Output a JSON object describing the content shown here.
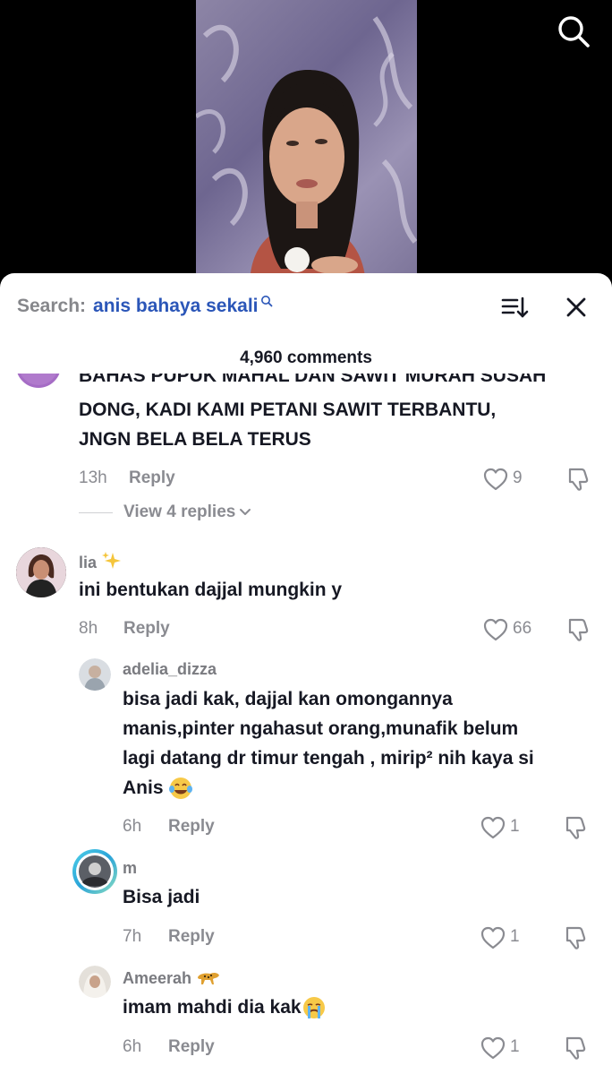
{
  "search": {
    "label": "Search:",
    "term": "anis bahaya sekali"
  },
  "comments_count": "4,960 comments",
  "comments": [
    {
      "text_cut": "BAHAS PUPUK MAHAL DAN SAWIT MURAH SUSAH",
      "text_lines": [
        "DONG, KADI KAMI PETANI SAWIT TERBANTU,",
        "JNGN BELA BELA TERUS"
      ],
      "time": "13h",
      "reply": "Reply",
      "likes": "9",
      "view_replies": "View 4 replies"
    },
    {
      "username": "lia",
      "text": "ini bentukan dajjal mungkin y",
      "time": "8h",
      "reply": "Reply",
      "likes": "66"
    }
  ],
  "replies": [
    {
      "username": "adelia_dizza",
      "text_lines": [
        "bisa jadi kak, dajjal kan omongannya",
        "manis,pinter ngahasut orang,munafik belum",
        "lagi datang dr timur tengah , mirip² nih kaya si",
        "Anis"
      ],
      "time": "6h",
      "reply": "Reply",
      "likes": "1"
    },
    {
      "username": "m",
      "text": "Bisa jadi",
      "time": "7h",
      "reply": "Reply",
      "likes": "1"
    },
    {
      "username": "Ameerah",
      "text": "imam mahdi dia kak",
      "time": "6h",
      "reply": "Reply",
      "likes": "1"
    }
  ],
  "colors": {
    "search_term": "#2b56b8",
    "muted": "#8a8b91",
    "text": "#161823"
  }
}
